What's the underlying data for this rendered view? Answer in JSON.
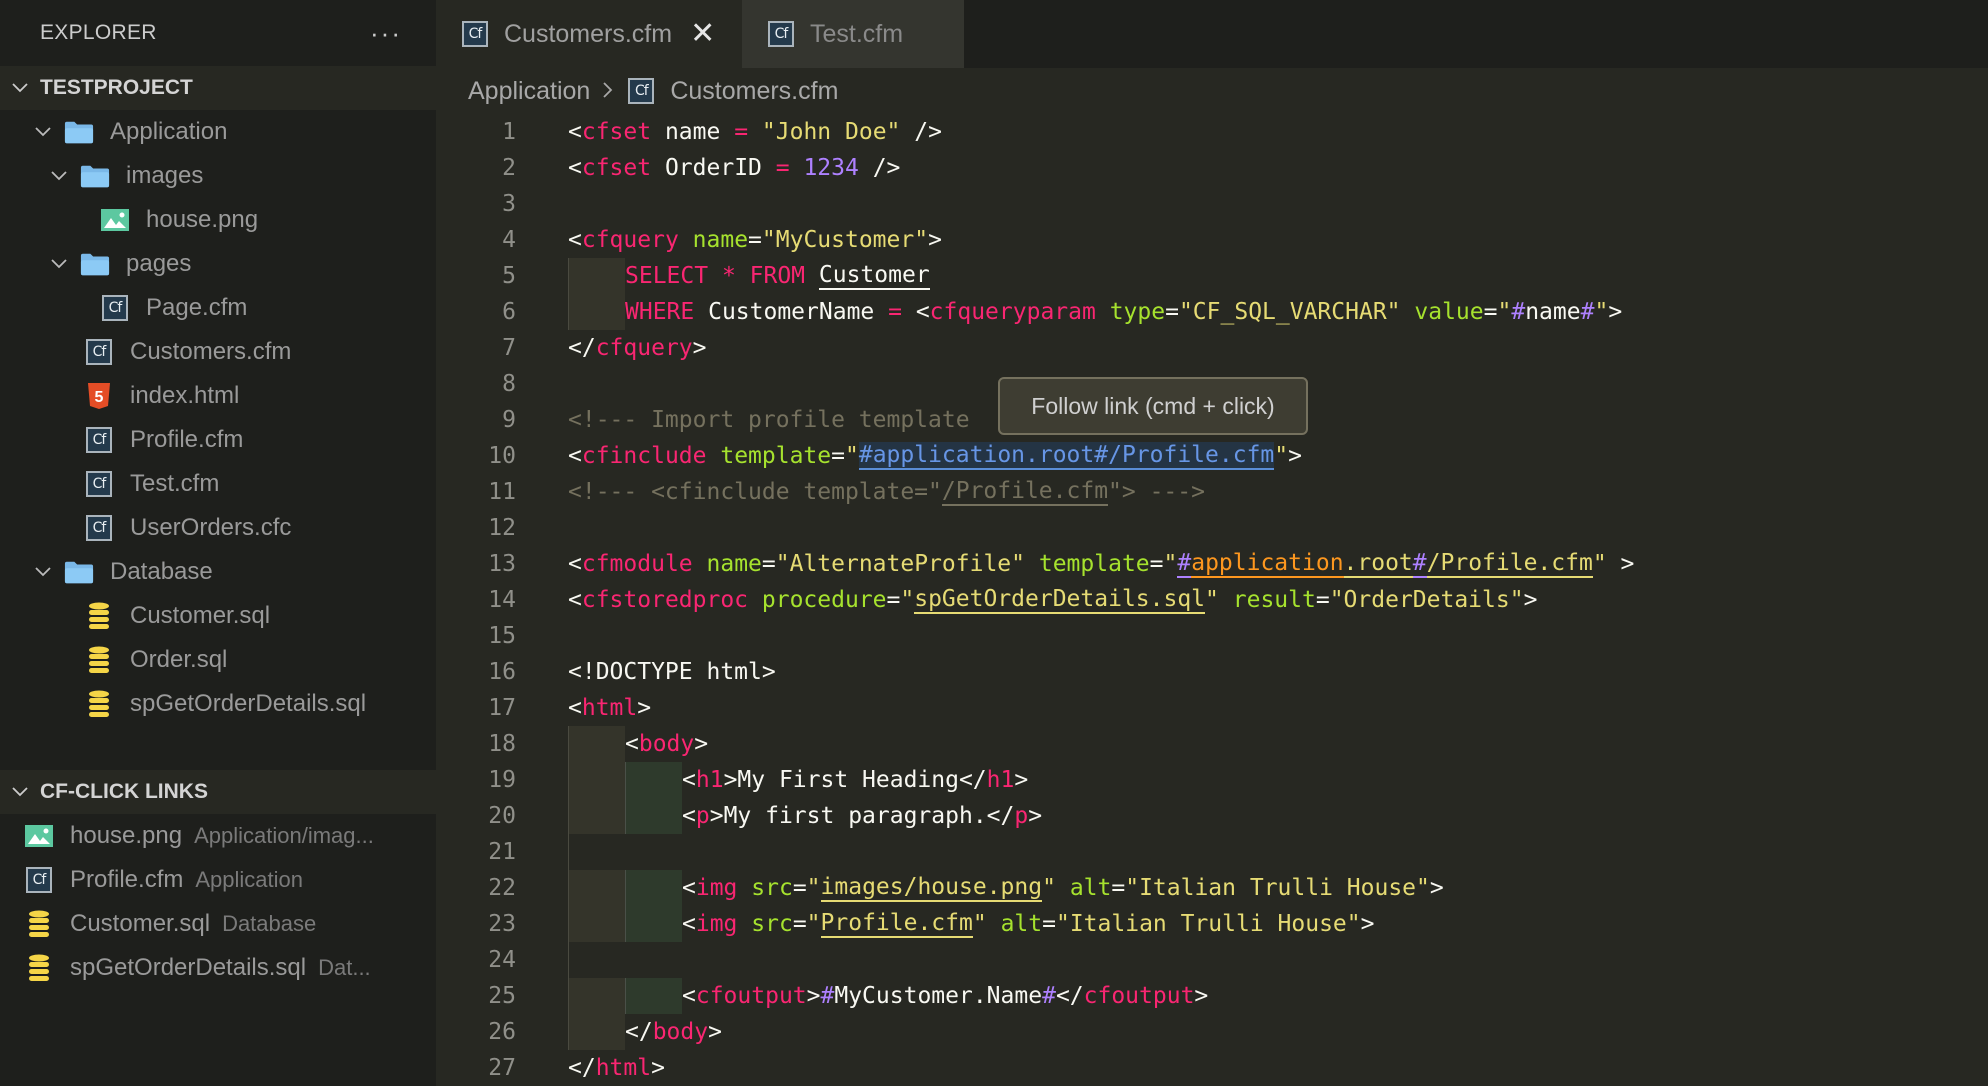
{
  "sidebar": {
    "title": "EXPLORER",
    "more_label": "···",
    "project": {
      "label": "TESTPROJECT",
      "items": [
        {
          "label": "Application",
          "type": "folder",
          "depth": 1,
          "expanded": true
        },
        {
          "label": "images",
          "type": "folder",
          "depth": 2,
          "expanded": true
        },
        {
          "label": "house.png",
          "type": "image",
          "depth": 3
        },
        {
          "label": "pages",
          "type": "folder",
          "depth": 2,
          "expanded": true
        },
        {
          "label": "Page.cfm",
          "type": "cf",
          "depth": 3
        },
        {
          "label": "Customers.cfm",
          "type": "cf",
          "depth": 2
        },
        {
          "label": "index.html",
          "type": "html",
          "depth": 2
        },
        {
          "label": "Profile.cfm",
          "type": "cf",
          "depth": 2
        },
        {
          "label": "Test.cfm",
          "type": "cf",
          "depth": 2
        },
        {
          "label": "UserOrders.cfc",
          "type": "cf",
          "depth": 2
        },
        {
          "label": "Database",
          "type": "folder",
          "depth": 1,
          "expanded": true
        },
        {
          "label": "Customer.sql",
          "type": "db",
          "depth": 2
        },
        {
          "label": "Order.sql",
          "type": "db",
          "depth": 2
        },
        {
          "label": "spGetOrderDetails.sql",
          "type": "db",
          "depth": 2
        }
      ]
    },
    "links": {
      "label": "CF-CLICK LINKS",
      "items": [
        {
          "label": "house.png",
          "desc": "Application/imag...",
          "type": "image"
        },
        {
          "label": "Profile.cfm",
          "desc": "Application",
          "type": "cf"
        },
        {
          "label": "Customer.sql",
          "desc": "Database",
          "type": "db"
        },
        {
          "label": "spGetOrderDetails.sql",
          "desc": "Dat...",
          "type": "db"
        }
      ]
    }
  },
  "tabs": [
    {
      "label": "Customers.cfm",
      "active": true,
      "icon": "cf-file-icon"
    },
    {
      "label": "Test.cfm",
      "active": false,
      "icon": "cf-file-icon"
    }
  ],
  "breadcrumb": {
    "folder": "Application",
    "separator": ">",
    "file": "Customers.cfm"
  },
  "tooltip": {
    "text": "Follow link (cmd + click)"
  },
  "icons": {
    "cf": "Cf",
    "chevron": "chevron-down-icon"
  },
  "editor": {
    "lines": [
      {
        "n": "1",
        "tokens": [
          [
            "<",
            "pun"
          ],
          [
            "cfset",
            "tag"
          ],
          [
            " name ",
            "pun"
          ],
          [
            "=",
            "tag"
          ],
          [
            " ",
            "pun"
          ],
          [
            "\"John Doe\"",
            "str"
          ],
          [
            " />",
            "pun"
          ]
        ]
      },
      {
        "n": "2",
        "tokens": [
          [
            "<",
            "pun"
          ],
          [
            "cfset",
            "tag"
          ],
          [
            " OrderID ",
            "pun"
          ],
          [
            "=",
            "tag"
          ],
          [
            " ",
            "pun"
          ],
          [
            "1234",
            "num"
          ],
          [
            " />",
            "pun"
          ]
        ]
      },
      {
        "n": "3",
        "tokens": []
      },
      {
        "n": "4",
        "tokens": [
          [
            "<",
            "pun"
          ],
          [
            "cfquery",
            "tag"
          ],
          [
            " ",
            "pun"
          ],
          [
            "name",
            "attr"
          ],
          [
            "=",
            "pun"
          ],
          [
            "\"MyCustomer\"",
            "str"
          ],
          [
            ">",
            "pun"
          ]
        ]
      },
      {
        "n": "5",
        "guides": 1,
        "tokens": [
          [
            "SELECT ",
            "tag"
          ],
          [
            "* ",
            "tag"
          ],
          [
            "FROM ",
            "tag"
          ],
          [
            "Customer",
            "pun u-white"
          ]
        ]
      },
      {
        "n": "6",
        "guides": 1,
        "tokens": [
          [
            "WHERE ",
            "tag"
          ],
          [
            "CustomerName ",
            "pun"
          ],
          [
            "=",
            "tag"
          ],
          [
            " <",
            "pun"
          ],
          [
            "cfqueryparam",
            "tag"
          ],
          [
            " ",
            "pun"
          ],
          [
            "type",
            "attr"
          ],
          [
            "=",
            "pun"
          ],
          [
            "\"CF_SQL_VARCHAR\"",
            "str"
          ],
          [
            " ",
            "pun"
          ],
          [
            "value",
            "attr"
          ],
          [
            "=",
            "pun"
          ],
          [
            "\"",
            "str"
          ],
          [
            "#",
            "hash"
          ],
          [
            "name",
            "pun"
          ],
          [
            "#",
            "hash"
          ],
          [
            "\"",
            "str"
          ],
          [
            ">",
            "pun"
          ]
        ]
      },
      {
        "n": "7",
        "tokens": [
          [
            "</",
            "pun"
          ],
          [
            "cfquery",
            "tag"
          ],
          [
            ">",
            "pun"
          ]
        ]
      },
      {
        "n": "8",
        "tokens": []
      },
      {
        "n": "9",
        "tokens": [
          [
            "<!--- Import profile template",
            "cmt"
          ]
        ]
      },
      {
        "n": "10",
        "tokens": [
          [
            "<",
            "pun"
          ],
          [
            "cfinclude",
            "tag"
          ],
          [
            " ",
            "pun"
          ],
          [
            "template",
            "attr"
          ],
          [
            "=",
            "pun"
          ],
          [
            "\"",
            "str"
          ],
          [
            "#application.root#/Profile.cfm",
            "link-hl"
          ],
          [
            "\"",
            "str"
          ],
          [
            ">",
            "pun"
          ]
        ]
      },
      {
        "n": "11",
        "tokens": [
          [
            "<!--- <cfinclude template=\"",
            "cmt"
          ],
          [
            "/Profile.cfm",
            "cmt u-cmt"
          ],
          [
            "\"> --->",
            "cmt"
          ]
        ]
      },
      {
        "n": "12",
        "tokens": []
      },
      {
        "n": "13",
        "tokens": [
          [
            "<",
            "pun"
          ],
          [
            "cfmodule",
            "tag"
          ],
          [
            " ",
            "pun"
          ],
          [
            "name",
            "attr"
          ],
          [
            "=",
            "pun"
          ],
          [
            "\"AlternateProfile\"",
            "str"
          ],
          [
            " ",
            "pun"
          ],
          [
            "template",
            "attr"
          ],
          [
            "=",
            "pun"
          ],
          [
            "\"",
            "str"
          ],
          [
            "#",
            "hash u-purple"
          ],
          [
            "application",
            "org u-org"
          ],
          [
            ".root",
            "str u-yellow"
          ],
          [
            "#",
            "hash u-purple"
          ],
          [
            "/Profile.cfm",
            "str u-yellow"
          ],
          [
            "\"",
            "str"
          ],
          [
            " >",
            "pun"
          ]
        ]
      },
      {
        "n": "14",
        "tokens": [
          [
            "<",
            "pun"
          ],
          [
            "cfstoredproc",
            "tag"
          ],
          [
            " ",
            "pun"
          ],
          [
            "procedure",
            "attr"
          ],
          [
            "=",
            "pun"
          ],
          [
            "\"",
            "str"
          ],
          [
            "spGetOrderDetails.sql",
            "str u-yellow"
          ],
          [
            "\"",
            "str"
          ],
          [
            " ",
            "pun"
          ],
          [
            "result",
            "attr"
          ],
          [
            "=",
            "pun"
          ],
          [
            "\"OrderDetails\"",
            "str"
          ],
          [
            ">",
            "pun"
          ]
        ]
      },
      {
        "n": "15",
        "tokens": []
      },
      {
        "n": "16",
        "tokens": [
          [
            "<!DOCTYPE html>",
            "pun"
          ]
        ]
      },
      {
        "n": "17",
        "tokens": [
          [
            "<",
            "pun"
          ],
          [
            "html",
            "tag"
          ],
          [
            ">",
            "pun"
          ]
        ]
      },
      {
        "n": "18",
        "guides": 1,
        "tokens": [
          [
            "<",
            "pun"
          ],
          [
            "body",
            "tag"
          ],
          [
            ">",
            "pun"
          ]
        ]
      },
      {
        "n": "19",
        "guides": 2,
        "tokens": [
          [
            "<",
            "pun"
          ],
          [
            "h1",
            "tag"
          ],
          [
            ">My First Heading</",
            "pun"
          ],
          [
            "h1",
            "tag"
          ],
          [
            ">",
            "pun"
          ]
        ]
      },
      {
        "n": "20",
        "guides": 2,
        "tokens": [
          [
            "<",
            "pun"
          ],
          [
            "p",
            "tag"
          ],
          [
            ">My first paragraph.</",
            "pun"
          ],
          [
            "p",
            "tag"
          ],
          [
            ">",
            "pun"
          ]
        ]
      },
      {
        "n": "21",
        "guides": 0,
        "tokens": []
      },
      {
        "n": "22",
        "guides": 2,
        "tokens": [
          [
            "<",
            "pun"
          ],
          [
            "img",
            "tag"
          ],
          [
            " ",
            "pun"
          ],
          [
            "src",
            "attr"
          ],
          [
            "=",
            "pun"
          ],
          [
            "\"",
            "str"
          ],
          [
            "images/house.png",
            "str u-yellow"
          ],
          [
            "\"",
            "str"
          ],
          [
            " ",
            "pun"
          ],
          [
            "alt",
            "attr"
          ],
          [
            "=",
            "pun"
          ],
          [
            "\"Italian Trulli House\"",
            "str"
          ],
          [
            ">",
            "pun"
          ]
        ]
      },
      {
        "n": "23",
        "guides": 2,
        "tokens": [
          [
            "<",
            "pun"
          ],
          [
            "img",
            "tag"
          ],
          [
            " ",
            "pun"
          ],
          [
            "src",
            "attr"
          ],
          [
            "=",
            "pun"
          ],
          [
            "\"",
            "str"
          ],
          [
            "Profile.cfm",
            "str u-yellow"
          ],
          [
            "\"",
            "str"
          ],
          [
            " ",
            "pun"
          ],
          [
            "alt",
            "attr"
          ],
          [
            "=",
            "pun"
          ],
          [
            "\"Italian Trulli House\"",
            "str"
          ],
          [
            ">",
            "pun"
          ]
        ]
      },
      {
        "n": "24",
        "guides": 0,
        "tokens": []
      },
      {
        "n": "25",
        "guides": 2,
        "tokens": [
          [
            "<",
            "pun"
          ],
          [
            "cfoutput",
            "tag"
          ],
          [
            ">",
            "pun"
          ],
          [
            "#",
            "hash"
          ],
          [
            "MyCustomer.Name",
            "pun"
          ],
          [
            "#",
            "hash"
          ],
          [
            "</",
            "pun"
          ],
          [
            "cfoutput",
            "tag"
          ],
          [
            ">",
            "pun"
          ]
        ]
      },
      {
        "n": "26",
        "guides": 1,
        "tokens": [
          [
            "</",
            "pun"
          ],
          [
            "body",
            "tag"
          ],
          [
            ">",
            "pun"
          ]
        ]
      },
      {
        "n": "27",
        "tokens": [
          [
            "</",
            "pun"
          ],
          [
            "html",
            "tag"
          ],
          [
            ">",
            "pun"
          ]
        ]
      }
    ]
  }
}
